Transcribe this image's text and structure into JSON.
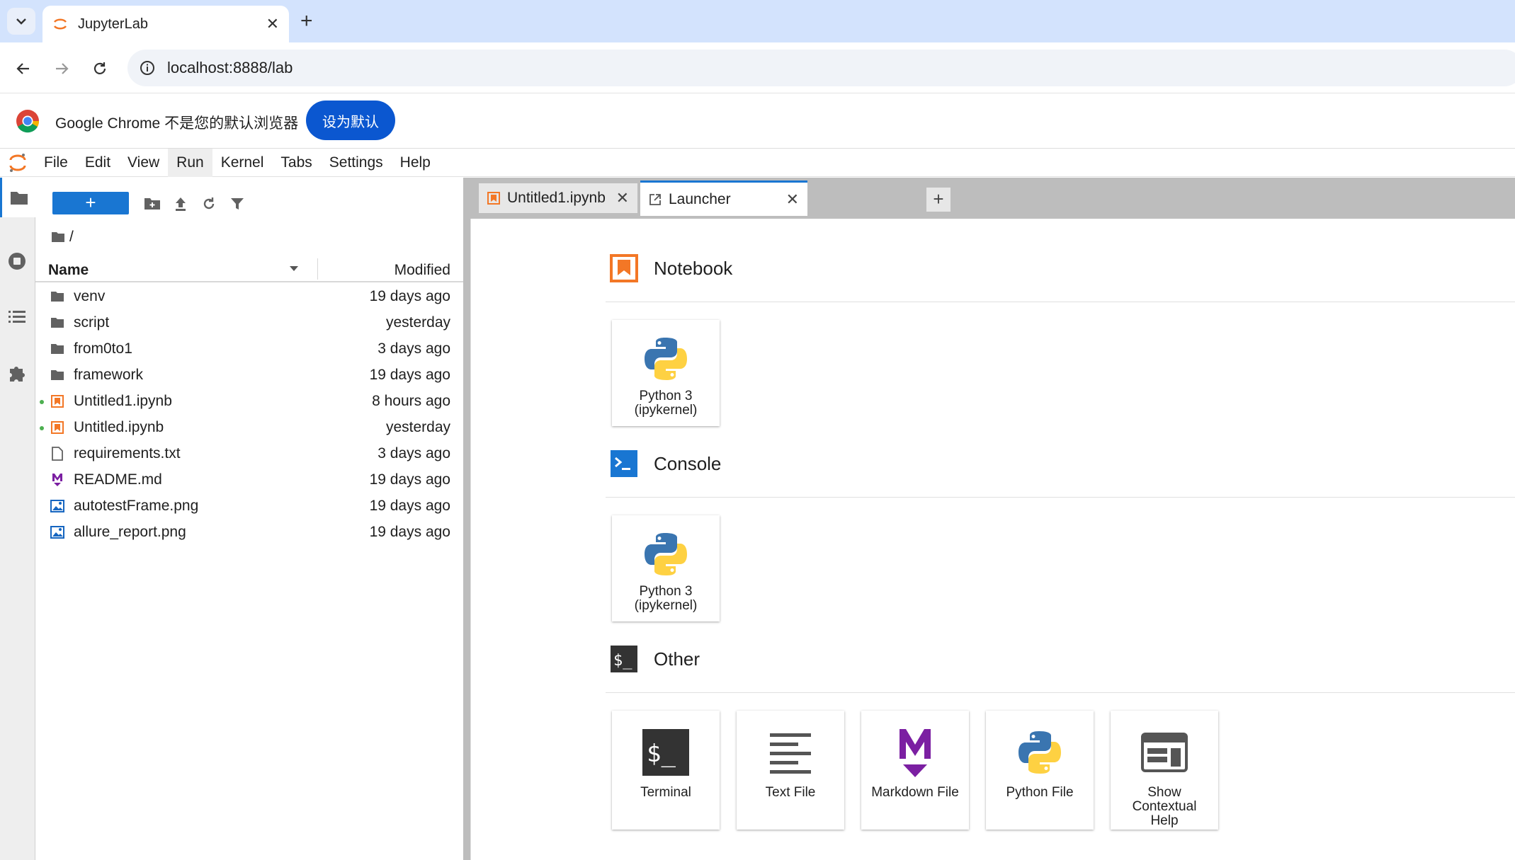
{
  "browser": {
    "tab_title": "JupyterLab",
    "url": "localhost:8888/lab",
    "infobar_message": "Google Chrome 不是您的默认浏览器",
    "infobar_button": "设为默认"
  },
  "menu": [
    "File",
    "Edit",
    "View",
    "Run",
    "Kernel",
    "Tabs",
    "Settings",
    "Help"
  ],
  "filebrowser": {
    "new_button": "+",
    "breadcrumb": "/",
    "col_name": "Name",
    "col_modified": "Modified",
    "files": [
      {
        "name": "venv",
        "modified": "19 days ago",
        "type": "folder"
      },
      {
        "name": "script",
        "modified": "yesterday",
        "type": "folder"
      },
      {
        "name": "from0to1",
        "modified": "3 days ago",
        "type": "folder"
      },
      {
        "name": "framework",
        "modified": "19 days ago",
        "type": "folder"
      },
      {
        "name": "Untitled1.ipynb",
        "modified": "8 hours ago",
        "type": "notebook",
        "running": true
      },
      {
        "name": "Untitled.ipynb",
        "modified": "yesterday",
        "type": "notebook",
        "running": true
      },
      {
        "name": "requirements.txt",
        "modified": "3 days ago",
        "type": "text"
      },
      {
        "name": "README.md",
        "modified": "19 days ago",
        "type": "markdown"
      },
      {
        "name": "autotestFrame.png",
        "modified": "19 days ago",
        "type": "image"
      },
      {
        "name": "allure_report.png",
        "modified": "19 days ago",
        "type": "image"
      }
    ]
  },
  "dock": {
    "tabs": [
      {
        "title": "Untitled1.ipynb",
        "icon": "notebook-icon"
      },
      {
        "title": "Launcher",
        "icon": "launcher-icon"
      }
    ],
    "add": "+"
  },
  "launcher": {
    "notebook": {
      "title": "Notebook",
      "items": [
        {
          "label1": "Python 3",
          "label2": "(ipykernel)"
        }
      ]
    },
    "console": {
      "title": "Console",
      "items": [
        {
          "label1": "Python 3",
          "label2": "(ipykernel)"
        }
      ]
    },
    "other": {
      "title": "Other",
      "items": [
        "Terminal",
        "Text File",
        "Markdown File",
        "Python File"
      ],
      "help": [
        "Show",
        "Contextual",
        "Help"
      ]
    }
  },
  "colors": {
    "accent": "#1976d2",
    "jupyter_orange": "#f37726",
    "markdown_purple": "#7b1fa2"
  }
}
